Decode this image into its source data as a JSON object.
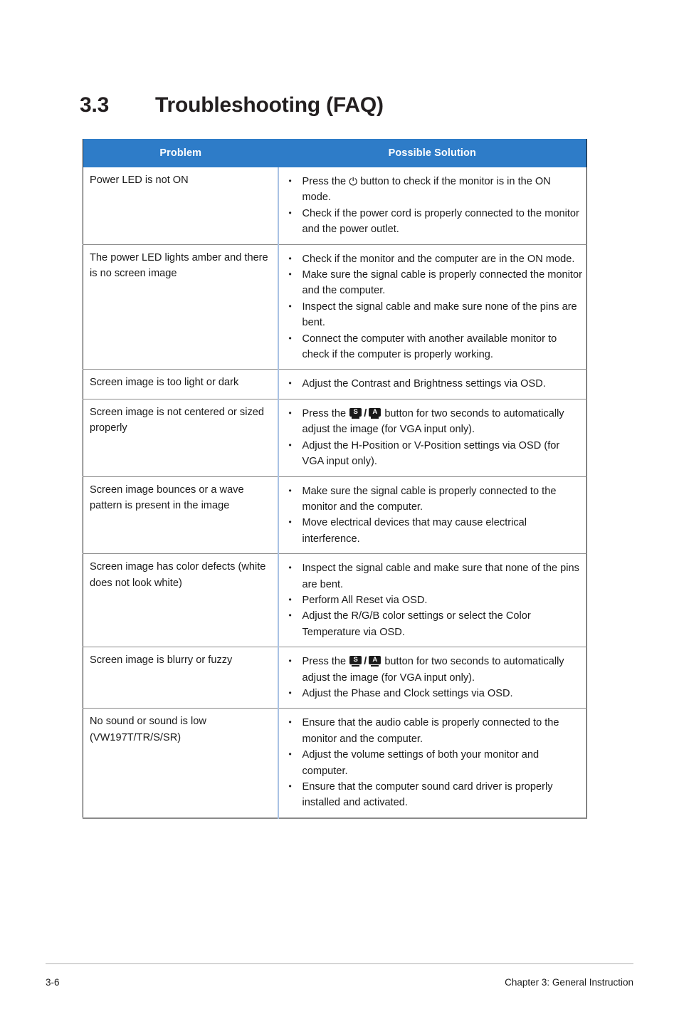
{
  "document": {
    "section_number": "3.3",
    "section_title": "Troubleshooting (FAQ)"
  },
  "table": {
    "headers": {
      "problem": "Problem",
      "solution": "Possible Solution"
    },
    "rows": [
      {
        "problem": "Power  LED is not ON",
        "solutions": [
          {
            "parts": [
              {
                "type": "text",
                "value": "Press the "
              },
              {
                "type": "icon",
                "icon": "power-icon",
                "glyph": "⏻"
              },
              {
                "type": "text",
                "value": " button to check if the monitor is in the ON mode."
              }
            ]
          },
          {
            "parts": [
              {
                "type": "text",
                "value": "Check if the power cord is properly connected to the monitor and the power outlet."
              }
            ]
          }
        ]
      },
      {
        "problem": "The power LED lights amber and there is no screen image",
        "solutions": [
          {
            "parts": [
              {
                "type": "text",
                "value": "Check if the monitor and the computer are in the ON mode."
              }
            ]
          },
          {
            "parts": [
              {
                "type": "text",
                "value": "Make sure the signal cable is properly connected the monitor and the computer."
              }
            ]
          },
          {
            "parts": [
              {
                "type": "text",
                "value": "Inspect the signal cable and make sure none of the pins are bent."
              }
            ]
          },
          {
            "parts": [
              {
                "type": "text",
                "value": "Connect the computer with another available monitor to check if the computer is properly working."
              }
            ]
          }
        ]
      },
      {
        "problem": "Screen image is too light or dark",
        "solutions": [
          {
            "parts": [
              {
                "type": "text",
                "value": "Adjust the Contrast and Brightness settings via OSD."
              }
            ]
          }
        ]
      },
      {
        "problem": "Screen image is not centered or sized properly",
        "solutions": [
          {
            "parts": [
              {
                "type": "text",
                "value": "Press the "
              },
              {
                "type": "icon",
                "icon": "select-button-icon",
                "glyph": "S"
              },
              {
                "type": "slash",
                "value": "/"
              },
              {
                "type": "icon",
                "icon": "auto-button-icon",
                "glyph": "A"
              },
              {
                "type": "text",
                "value": " button for two seconds to automatically adjust the image (for VGA input only)."
              }
            ]
          },
          {
            "parts": [
              {
                "type": "text",
                "value": "Adjust the H-Position or V-Position settings via OSD (for VGA input only)."
              }
            ]
          }
        ]
      },
      {
        "problem": "Screen image bounces or a wave pattern is present in the image",
        "solutions": [
          {
            "parts": [
              {
                "type": "text",
                "value": "Make sure the signal cable is properly connected to the monitor and the computer."
              }
            ]
          },
          {
            "parts": [
              {
                "type": "text",
                "value": "Move electrical devices that may cause electrical interference."
              }
            ]
          }
        ]
      },
      {
        "problem": "Screen image has color defects (white does not look white)",
        "solutions": [
          {
            "parts": [
              {
                "type": "text",
                "value": "Inspect the signal cable and make sure that none of the pins are bent."
              }
            ]
          },
          {
            "parts": [
              {
                "type": "text",
                "value": "Perform All Reset via OSD."
              }
            ]
          },
          {
            "parts": [
              {
                "type": "text",
                "value": "Adjust the R/G/B color settings or select the Color Temperature via OSD."
              }
            ]
          }
        ]
      },
      {
        "problem": "Screen image is blurry or fuzzy",
        "solutions": [
          {
            "parts": [
              {
                "type": "text",
                "value": "Press the "
              },
              {
                "type": "icon",
                "icon": "select-button-icon",
                "glyph": "S"
              },
              {
                "type": "slash",
                "value": "/"
              },
              {
                "type": "icon",
                "icon": "auto-button-icon",
                "glyph": "A"
              },
              {
                "type": "text",
                "value": " button for two seconds to automatically adjust the image  (for VGA input only)."
              }
            ]
          },
          {
            "parts": [
              {
                "type": "text",
                "value": "Adjust the Phase and Clock settings via OSD."
              }
            ]
          }
        ]
      },
      {
        "problem": "No sound or sound is low (VW197T/TR/S/SR)",
        "solutions": [
          {
            "parts": [
              {
                "type": "text",
                "value": "Ensure that the audio cable is properly connected to the monitor and the computer."
              }
            ]
          },
          {
            "parts": [
              {
                "type": "text",
                "value": "Adjust the volume settings of both your monitor and computer."
              }
            ]
          },
          {
            "parts": [
              {
                "type": "text",
                "value": "Ensure that the computer sound card driver is properly installed and activated."
              }
            ]
          }
        ]
      }
    ]
  },
  "footer": {
    "page_number": "3-6",
    "chapter": "Chapter 3: General Instruction"
  },
  "colors": {
    "header_blue": "#2e7cc8",
    "column_divider": "#a9c2e4",
    "row_divider": "#8a8a8a",
    "text": "#1a1a1a"
  }
}
